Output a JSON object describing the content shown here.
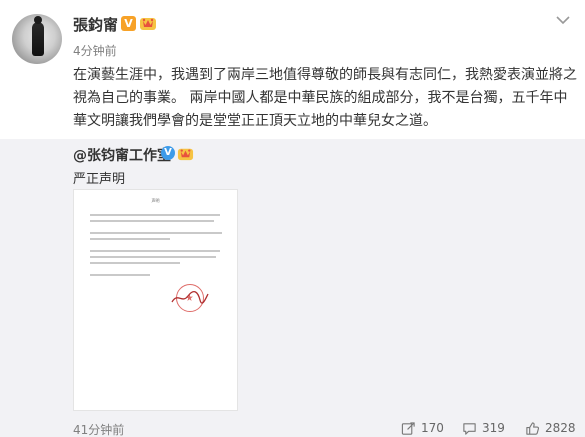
{
  "post": {
    "author": "張鈞甯",
    "verified_badge": "V",
    "time": "4分钟前",
    "text": "在演藝生涯中，我遇到了兩岸三地值得尊敬的師長與有志同仁，我熱愛表演並將之視為自己的事業。 兩岸中國人都是中華民族的組成部分，我不是台獨，五千年中華文明讓我們學會的是堂堂正正頂天立地的中華兒女之道。"
  },
  "repost": {
    "author": "@张钧甯工作室",
    "verified_badge": "V",
    "text": "严正声明",
    "time": "41分钟前",
    "document": {
      "title": "声明"
    },
    "actions": {
      "share_count": "170",
      "comment_count": "319",
      "like_count": "2828"
    }
  },
  "icons": {
    "menu": "chevron-down-icon",
    "share": "share-icon",
    "comment": "comment-icon",
    "like": "thumbs-up-icon"
  },
  "colors": {
    "vip_badge": "#f7a228",
    "blue_badge": "#3d9be9",
    "repost_bg": "#f2f2f5",
    "seal_red": "#d9534f"
  }
}
